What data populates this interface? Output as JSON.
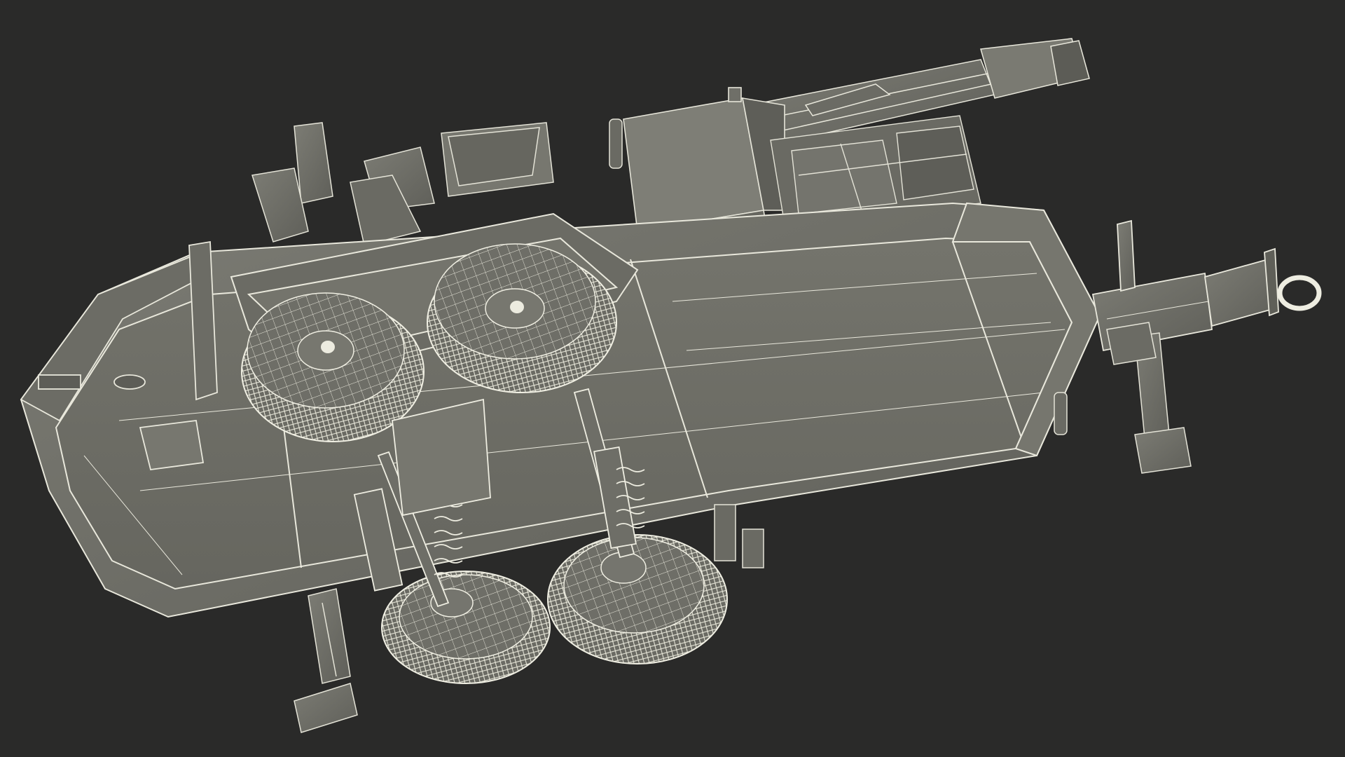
{
  "scene": {
    "colors": {
      "background": "#2a2a29",
      "body_fill": "#707069",
      "body_light": "#828279",
      "body_dark": "#55554f",
      "wire": "#f2f1e6",
      "edge": "#d8d7cb",
      "hub": "#ecebdf"
    }
  }
}
